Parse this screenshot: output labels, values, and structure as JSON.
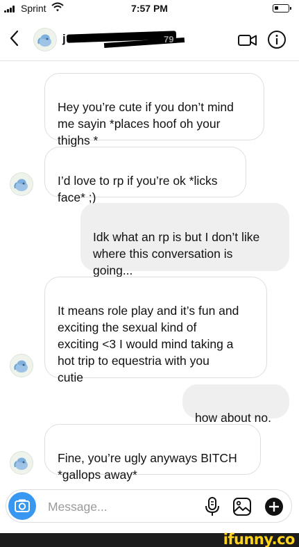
{
  "status_bar": {
    "carrier": "Sprint",
    "time": "7:57 PM"
  },
  "header": {
    "username_visible": "j",
    "username_fragment": "79",
    "back_icon": "chevron-left-icon",
    "video_icon": "video-camera-icon",
    "info_icon": "info-icon"
  },
  "messages": [
    {
      "sender": "them",
      "text": "Hey you’re cute if you don’t mind\nme sayin *places hoof oh your\nthighs *",
      "show_avatar": false
    },
    {
      "sender": "them",
      "text": "I’d love to rp if you’re ok *licks\nface* ;)",
      "show_avatar": true
    },
    {
      "sender": "me",
      "text": "Idk what an rp is but I don’t like\nwhere this conversation is\ngoing..."
    },
    {
      "sender": "them",
      "text": "It means role play and it’s fun and\nexciting the sexual kind of\nexciting <3 I would mind taking a\nhot trip to equestria with you\ncutie",
      "show_avatar": true
    },
    {
      "sender": "me",
      "text": "how about no."
    },
    {
      "sender": "them",
      "text": "Fine, you’re ugly anyways BITCH\n*gallops away*",
      "show_avatar": true
    }
  ],
  "composer": {
    "placeholder": "Message...",
    "camera_icon": "camera-icon",
    "mic_icon": "microphone-icon",
    "gallery_icon": "image-icon",
    "plus_icon": "plus-circle-icon"
  },
  "watermark": {
    "text": "ifunny.co"
  },
  "colors": {
    "accent_blue": "#3897f0",
    "outgoing_bubble": "#efefef",
    "incoming_border": "#dedede",
    "watermark_yellow": "#ffd41a"
  }
}
